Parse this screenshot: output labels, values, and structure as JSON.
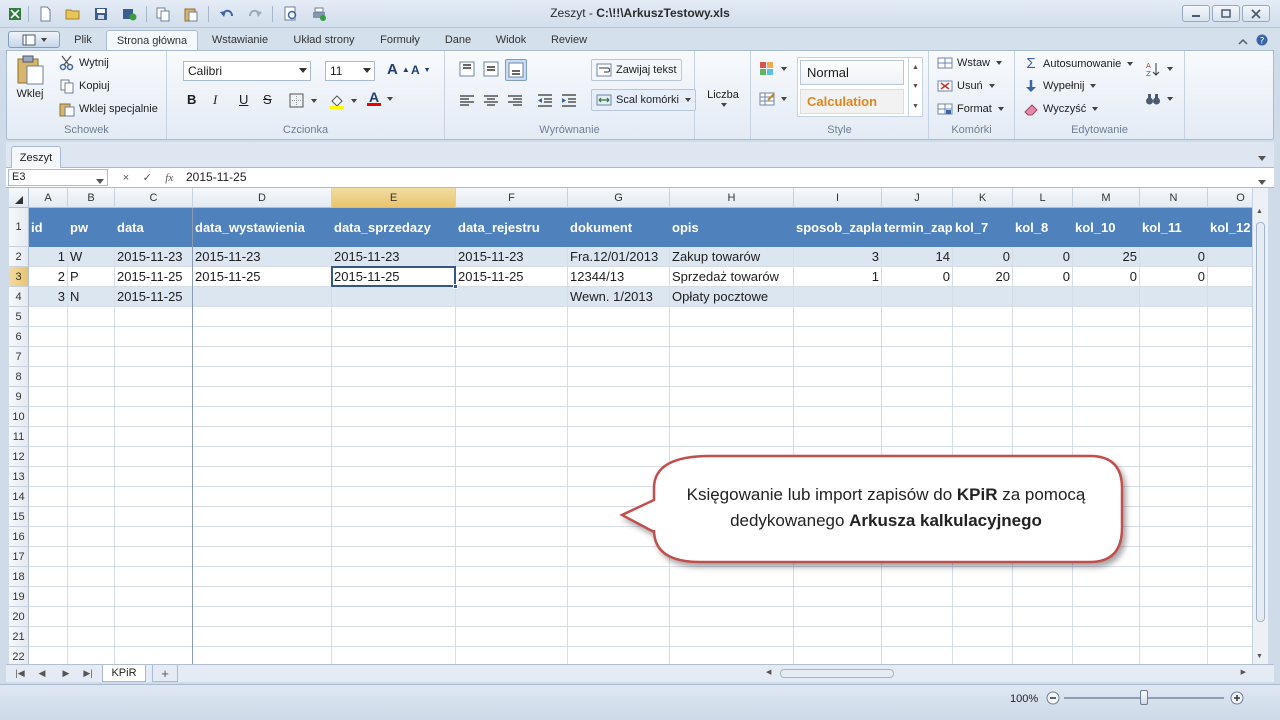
{
  "window": {
    "title_prefix": "Zeszyt - ",
    "title_path": "C:\\!!\\ArkuszTestowy.xls"
  },
  "tabs": [
    "Plik",
    "Strona główna",
    "Wstawianie",
    "Układ strony",
    "Formuły",
    "Dane",
    "Widok",
    "Review"
  ],
  "ribbon": {
    "clipboard": {
      "label": "Schowek",
      "paste": "Wklej",
      "cut": "Wytnij",
      "copy": "Kopiuj",
      "paste_special": "Wklej specjalnie"
    },
    "font": {
      "label": "Czcionka",
      "name": "Calibri",
      "size": "11",
      "bold": "B",
      "italic": "I",
      "underline": "U",
      "strike": "S",
      "color_letter": "A",
      "grow": "A",
      "shrink": "A"
    },
    "alignment": {
      "label": "Wyrównanie",
      "wrap": "Zawijaj tekst",
      "merge": "Scal komórki"
    },
    "number": {
      "label": "Liczba"
    },
    "styles": {
      "label": "Style",
      "normal": "Normal",
      "calculation": "Calculation"
    },
    "cells": {
      "label": "Komórki",
      "insert": "Wstaw",
      "delete": "Usuń",
      "format": "Format"
    },
    "editing": {
      "label": "Edytowanie",
      "autosum": "Autosumowanie",
      "fill": "Wypełnij",
      "clear": "Wyczyść"
    }
  },
  "doc_tab": "Zeszyt",
  "formula_bar": {
    "name_box": "E3",
    "cancel": "×",
    "confirm": "✓",
    "fx": "fx",
    "value": "2015-11-25"
  },
  "columns": [
    "A",
    "B",
    "C",
    "D",
    "E",
    "F",
    "G",
    "H",
    "I",
    "J",
    "K",
    "L",
    "M",
    "N",
    "O"
  ],
  "row_numbers": [
    "1",
    "2",
    "3",
    "4",
    "5",
    "6",
    "7",
    "8",
    "9",
    "10",
    "11",
    "12",
    "13",
    "14",
    "15",
    "16",
    "17",
    "18",
    "19",
    "20",
    "21",
    "22"
  ],
  "rows": [
    [
      "id",
      "pw",
      "data",
      "data_wystawienia",
      "data_sprzedazy",
      "data_rejestru",
      "dokument",
      "opis",
      "sposob_zapla",
      "termin_zap",
      "kol_7",
      "kol_8",
      "kol_10",
      "kol_11",
      "kol_12"
    ],
    [
      "1",
      "W",
      "2015-11-23",
      "2015-11-23",
      "2015-11-23",
      "2015-11-23",
      "Fra.12/01/2013",
      "Zakup towarów",
      "3",
      "14",
      "0",
      "0",
      "25",
      "0",
      ""
    ],
    [
      "2",
      "P",
      "2015-11-25",
      "2015-11-25",
      "2015-11-25",
      "2015-11-25",
      "12344/13",
      "Sprzedaż towarów",
      "1",
      "0",
      "20",
      "0",
      "0",
      "0",
      ""
    ],
    [
      "3",
      "N",
      "2015-11-25",
      "",
      "",
      "",
      "Wewn. 1/2013",
      "Opłaty pocztowe",
      "",
      "",
      "",
      "",
      "",
      "",
      ""
    ]
  ],
  "sheet_tabs": [
    "KPiR"
  ],
  "status": {
    "zoom": "100%"
  },
  "callout": {
    "t1": "Księgowanie lub import zapisów do ",
    "b1": "KPiR",
    "t2": " za pomocą dedykowanego ",
    "b2": "Arkusza kalkulacyjnego"
  },
  "colors": {
    "header_blue": "#4f81bd",
    "band": "#dce6f1",
    "callout_border": "#c0504d",
    "calculation_orange": "#e2861c"
  }
}
